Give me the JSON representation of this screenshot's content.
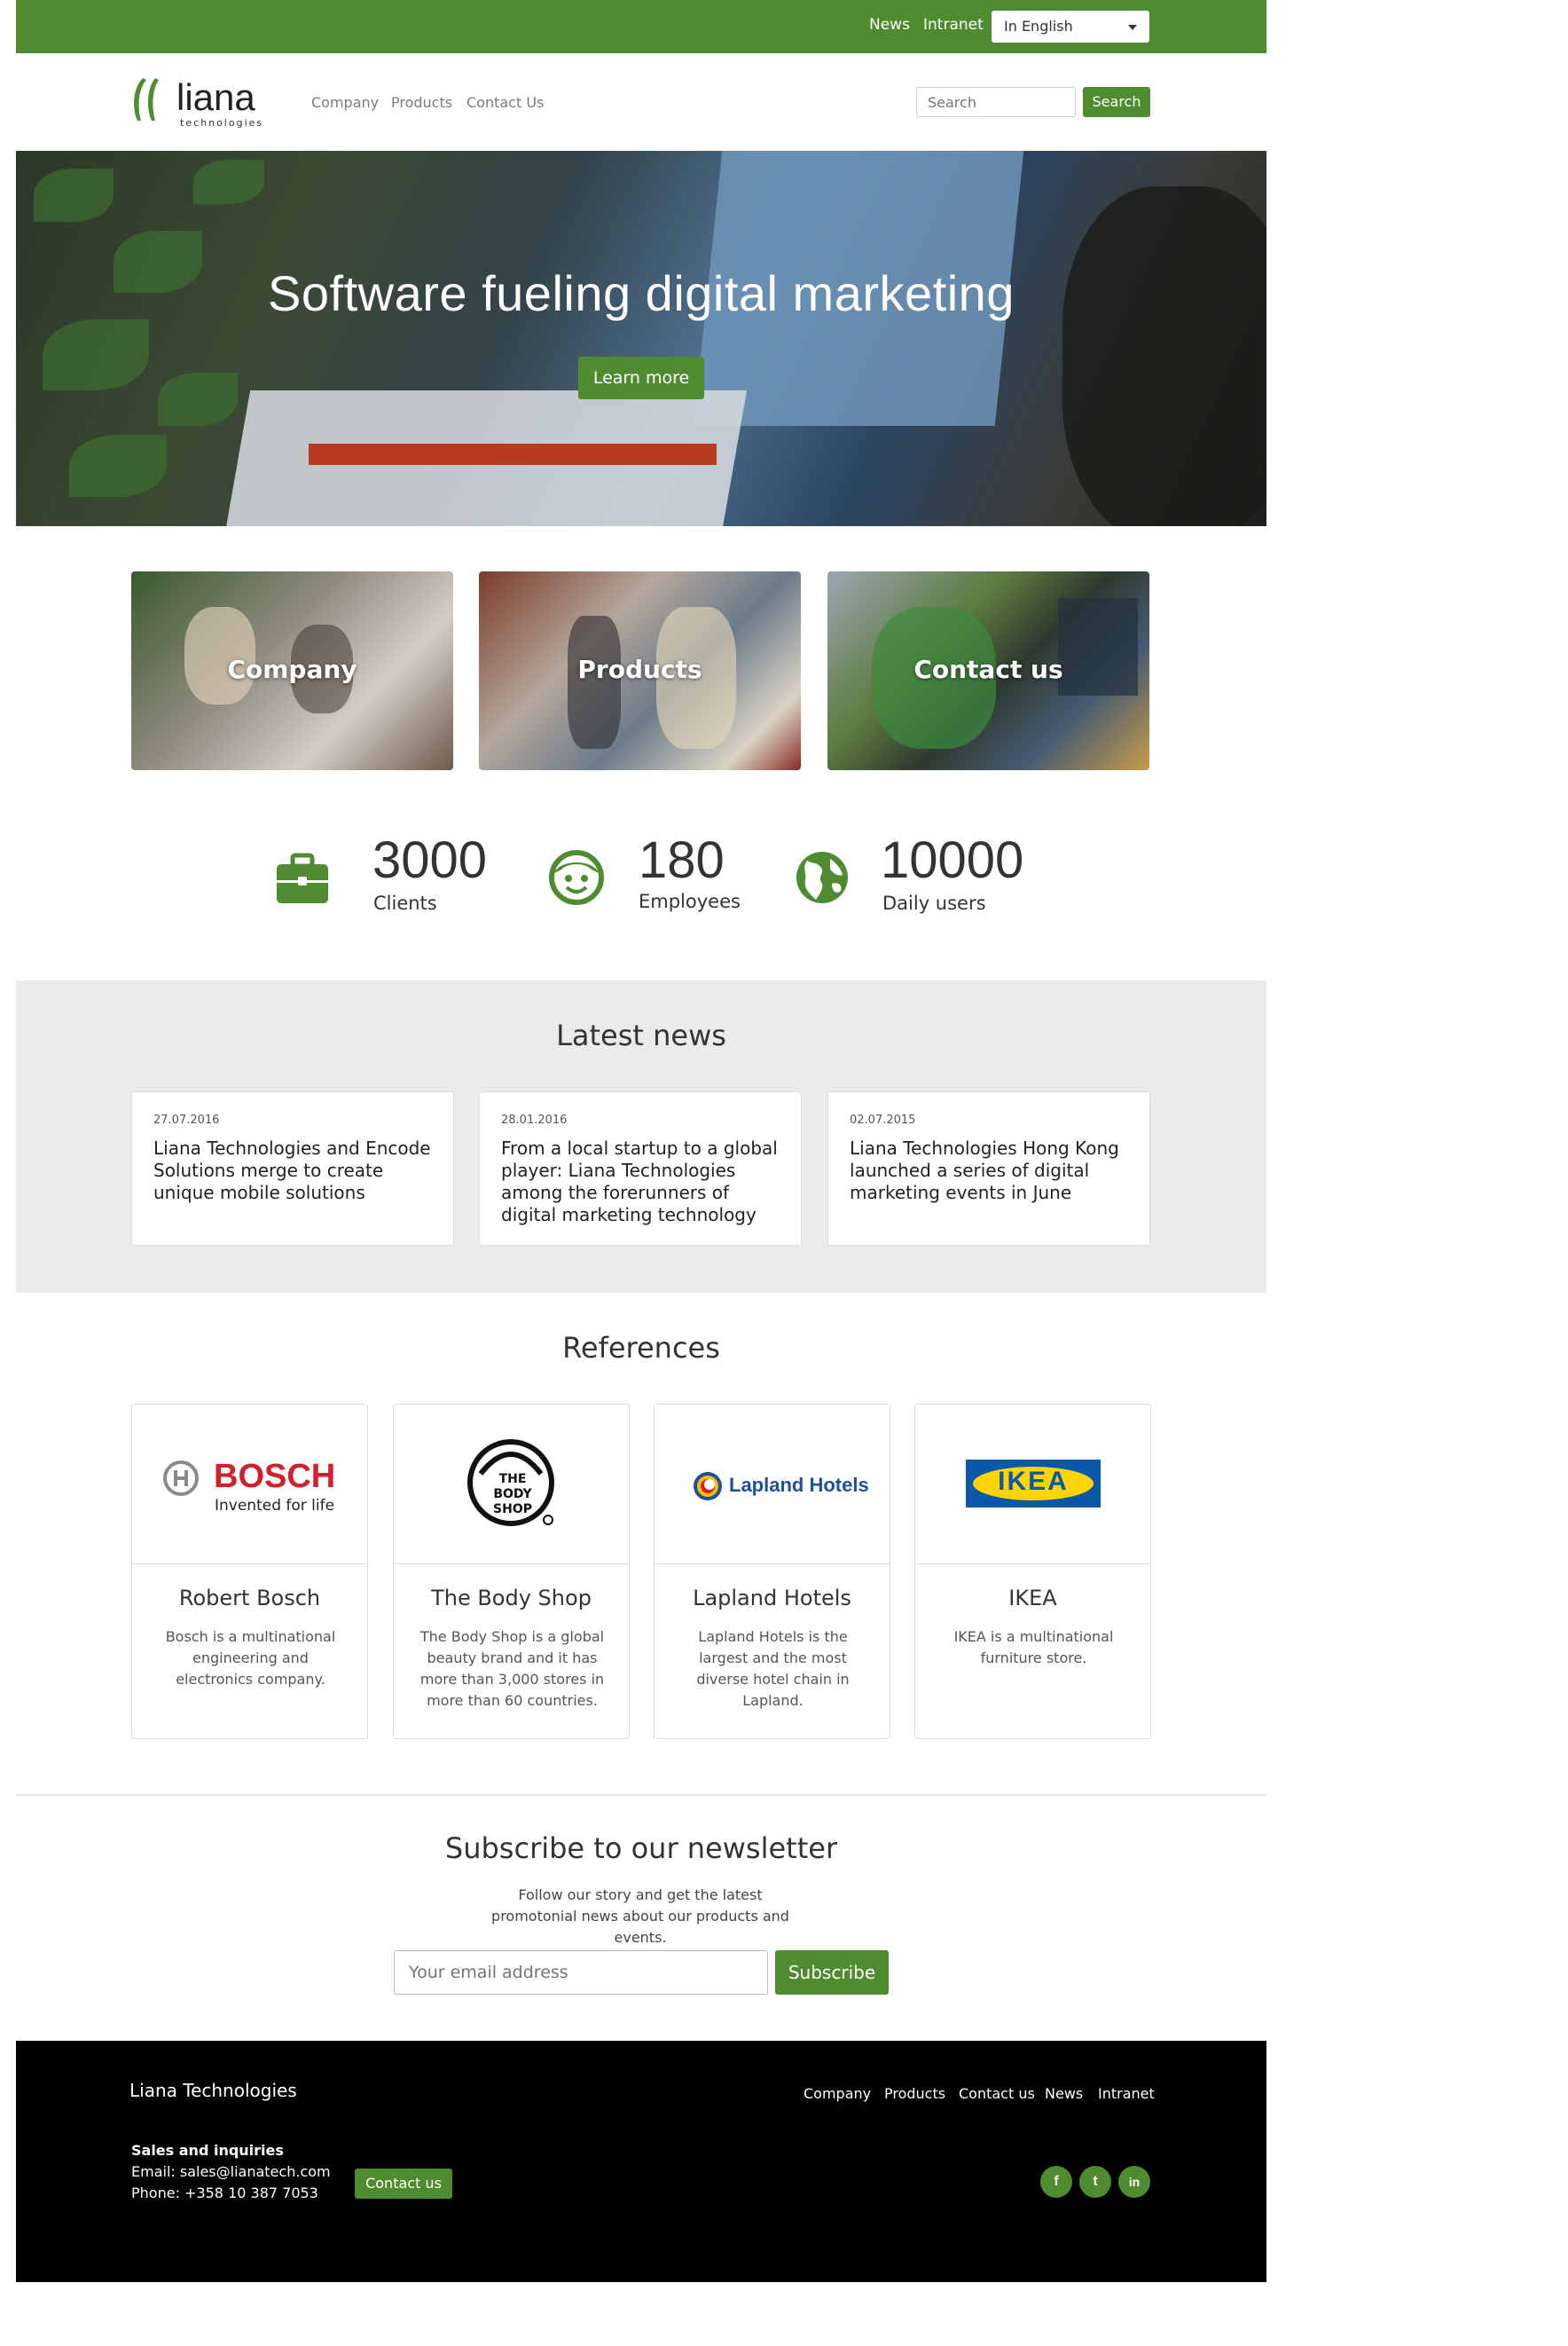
{
  "topbar": {
    "links": [
      "News",
      "Intranet"
    ],
    "language": "In English"
  },
  "header": {
    "logo_text": "liana",
    "logo_sub": "technologies",
    "nav": [
      "Company",
      "Products",
      "Contact Us"
    ],
    "search_placeholder": "Search",
    "search_button": "Search"
  },
  "hero": {
    "title": "Software fueling digital marketing",
    "button": "Learn more"
  },
  "tiles": [
    "Company",
    "Products",
    "Contact us"
  ],
  "stats": [
    {
      "value": "3000",
      "label": "Clients",
      "icon": "briefcase-icon"
    },
    {
      "value": "180",
      "label": "Employees",
      "icon": "smiley-face-icon"
    },
    {
      "value": "10000",
      "label": "Daily users",
      "icon": "globe-icon"
    }
  ],
  "news": {
    "title": "Latest news",
    "items": [
      {
        "date": "27.07.2016",
        "headline": "Liana Technologies and Encode Solutions merge to create unique mobile solutions"
      },
      {
        "date": "28.01.2016",
        "headline": "From a local startup to a global player: Liana Technologies among the forerunners of digital marketing technology"
      },
      {
        "date": "02.07.2015",
        "headline": "Liana Technologies Hong Kong launched a series of digital marketing events in June"
      }
    ]
  },
  "references": {
    "title": "References",
    "items": [
      {
        "name": "Robert Bosch",
        "desc": "Bosch is a multinational engineering and electronics company.",
        "logo_text": "BOSCH",
        "logo_sub": "Invented for life"
      },
      {
        "name": "The Body Shop",
        "desc": "The Body Shop is a global beauty brand and it has more than 3,000 stores in more than 60 countries.",
        "logo_text": "THE BODY SHOP"
      },
      {
        "name": "Lapland Hotels",
        "desc": "Lapland Hotels is the largest and the most diverse hotel chain in Lapland.",
        "logo_text": "Lapland Hotels"
      },
      {
        "name": "IKEA",
        "desc": "IKEA is a multinational furniture store.",
        "logo_text": "IKEA"
      }
    ]
  },
  "newsletter": {
    "title": "Subscribe to our newsletter",
    "text": "Follow our story and get the latest promotonial news about our products and events.",
    "placeholder": "Your email address",
    "button": "Subscribe"
  },
  "footer": {
    "brand": "Liana Technologies",
    "links": [
      "Company",
      "Products",
      "Contact us",
      "News",
      "Intranet"
    ],
    "sales_title": "Sales and inquiries",
    "email": "Email: sales@lianatech.com",
    "phone": "Phone: +358 10 387 7053",
    "contact_button": "Contact us",
    "social": [
      "f",
      "t",
      "in"
    ]
  },
  "colors": {
    "accent": "#4f8c2f",
    "footer_bg": "#000000",
    "news_bg": "#ebebeb"
  }
}
